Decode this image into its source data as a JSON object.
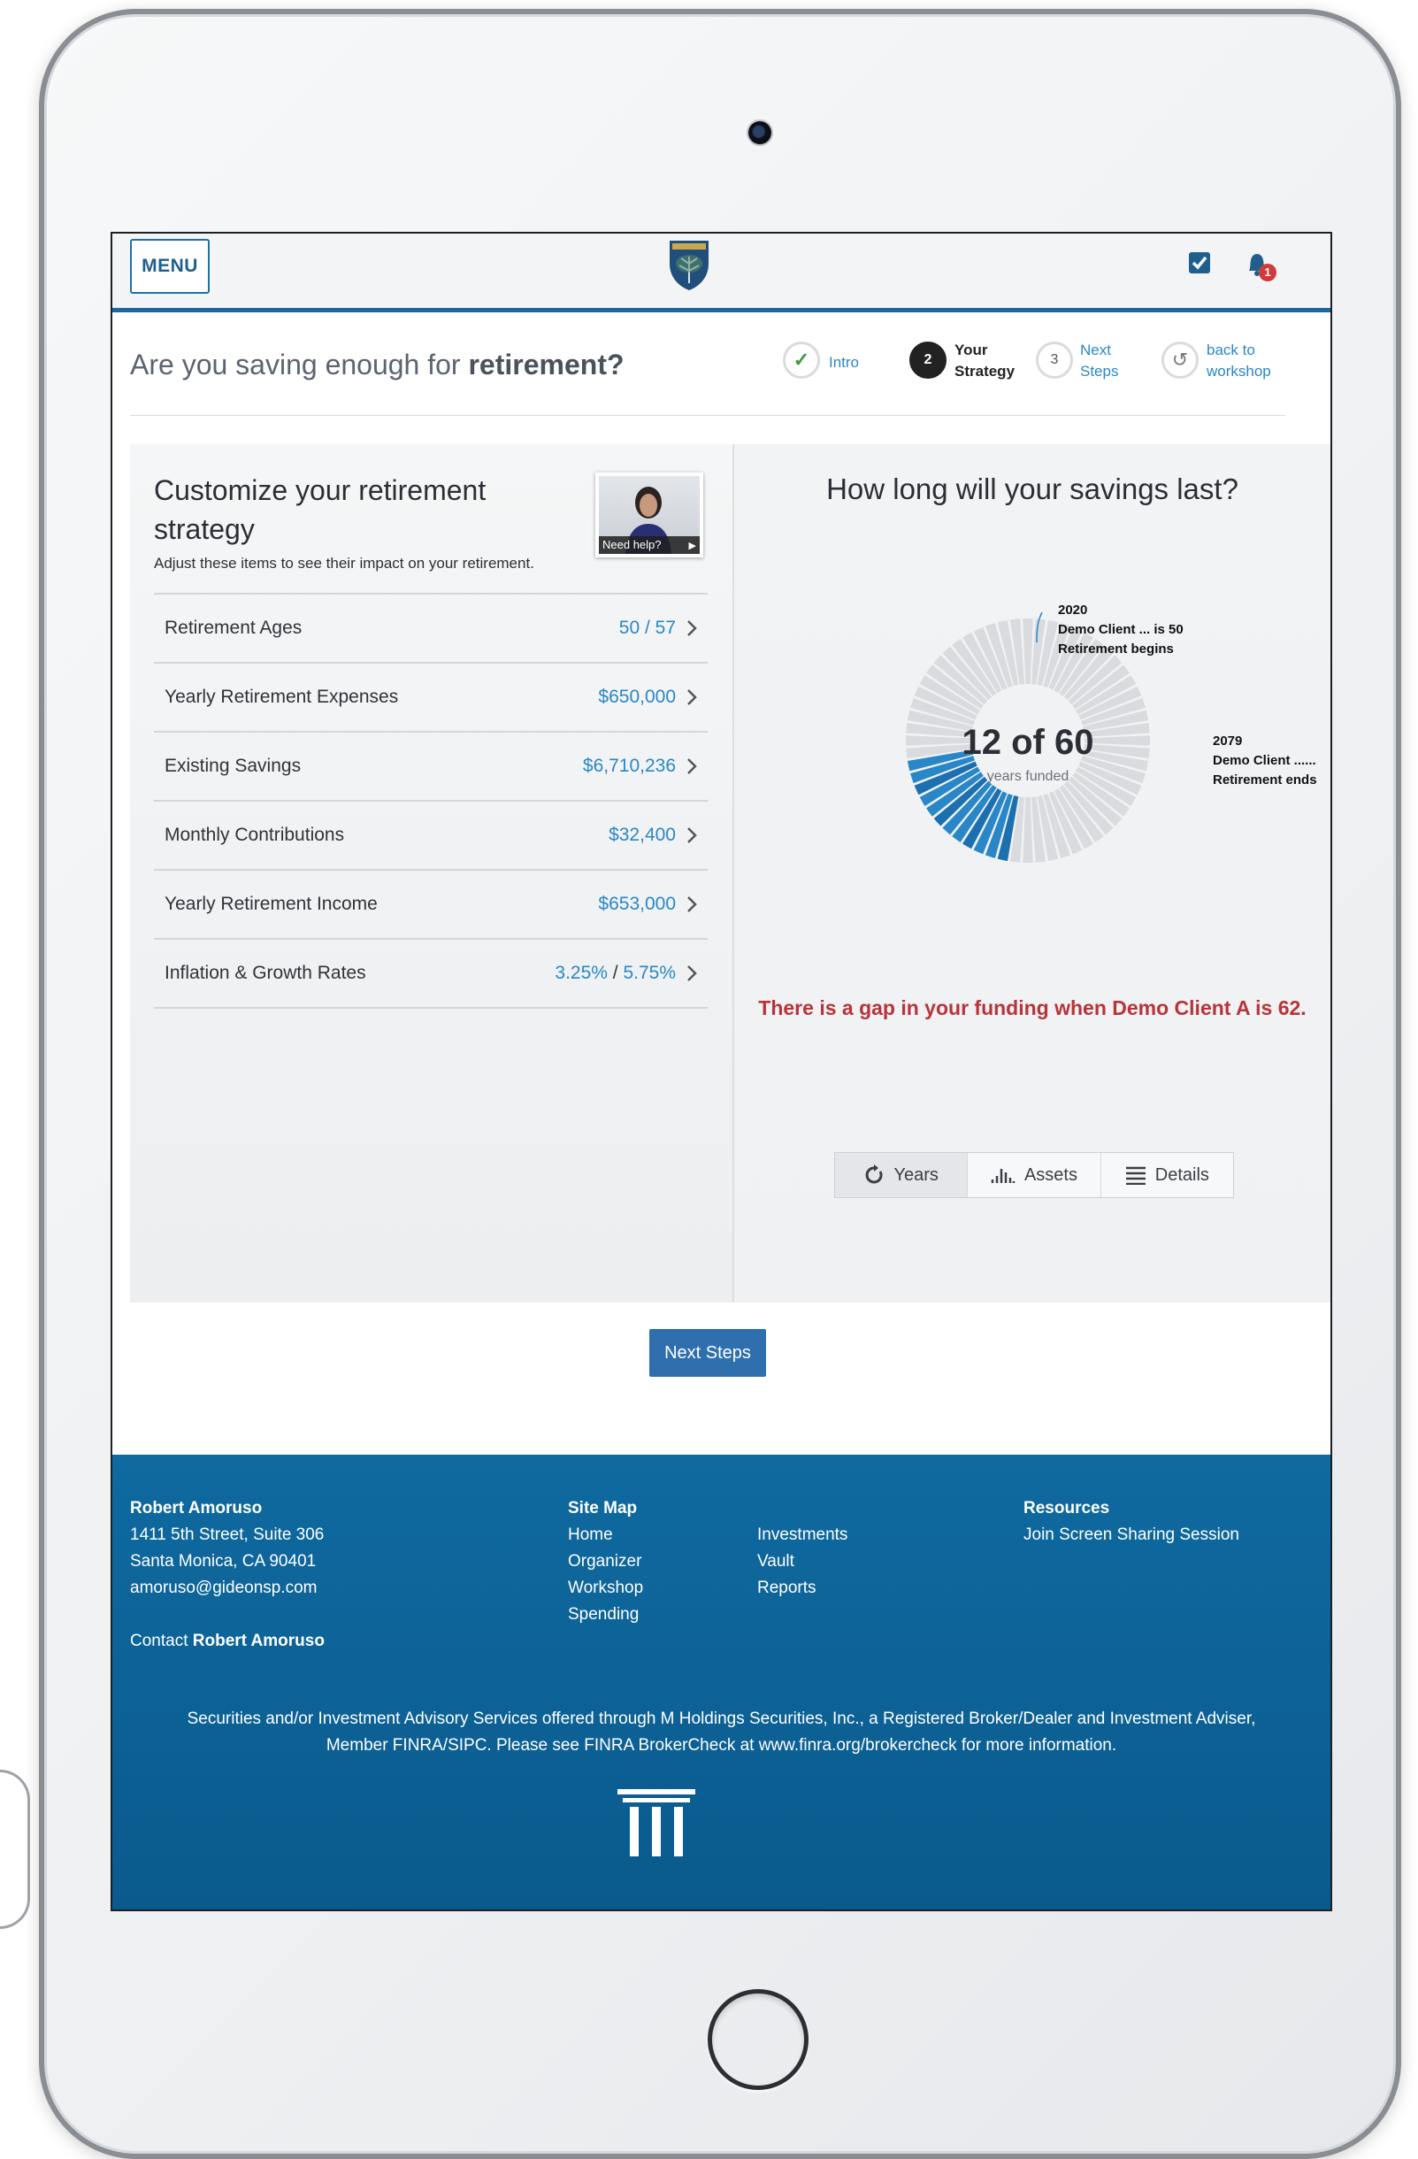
{
  "topbar": {
    "menu_label": "MENU",
    "notification_count": "1"
  },
  "header": {
    "title_prefix": "Are you saving enough for ",
    "title_bold": "retirement?"
  },
  "steps": [
    {
      "marker": "✓",
      "label_line1": "Intro",
      "label_line2": "",
      "state": "done"
    },
    {
      "marker": "2",
      "label_line1": "Your",
      "label_line2": "Strategy",
      "state": "active"
    },
    {
      "marker": "3",
      "label_line1": "Next",
      "label_line2": "Steps",
      "state": "pending"
    },
    {
      "marker": "↺",
      "label_line1": "back to",
      "label_line2": "workshop",
      "state": "link"
    }
  ],
  "customize": {
    "heading": "Customize your retirement strategy",
    "subheading": "Adjust these items to see their impact on your retirement.",
    "video_caption": "Need help?",
    "items": [
      {
        "label": "Retirement Ages",
        "value_a": "50",
        "sep": " / ",
        "value_b": "57"
      },
      {
        "label": "Yearly Retirement Expenses",
        "value_a": "$650,000",
        "sep": "",
        "value_b": ""
      },
      {
        "label": "Existing Savings",
        "value_a": "$6,710,236",
        "sep": "",
        "value_b": ""
      },
      {
        "label": "Monthly Contributions",
        "value_a": "$32,400",
        "sep": "",
        "value_b": ""
      },
      {
        "label": "Yearly Retirement Income",
        "value_a": "$653,000",
        "sep": "",
        "value_b": ""
      },
      {
        "label": "Inflation & Growth Rates",
        "value_a": "3.25%",
        "sep": " / ",
        "value_b": "5.75%"
      }
    ]
  },
  "chart": {
    "title": "How long will your savings last?",
    "center_big": "12 of 60",
    "center_small": "years funded",
    "start_label": {
      "year": "2020",
      "line1": "Demo Client ... is 50",
      "line2": "Retirement begins"
    },
    "end_label": {
      "year": "2079",
      "line1": "Demo Client ......",
      "line2": "Retirement ends"
    },
    "gap_message": "There is a gap in your funding when Demo Client A is 62.",
    "colors": {
      "funded": "#2a87c7",
      "funded_dark": "#1c70b0",
      "unfunded": "#d9dbde",
      "gap": "#b7343a"
    },
    "views": [
      {
        "label": "Years",
        "icon": "refresh-icon",
        "active": true
      },
      {
        "label": "Assets",
        "icon": "bar-chart-icon",
        "active": false
      },
      {
        "label": "Details",
        "icon": "list-icon",
        "active": false
      }
    ]
  },
  "chart_data": {
    "type": "pie",
    "title": "How long will your savings last?",
    "categories": [
      "years funded",
      "years unfunded"
    ],
    "values": [
      12,
      48
    ],
    "total_segments": 60,
    "start_year": 2020,
    "end_year": 2079
  },
  "actions": {
    "next_steps": "Next Steps"
  },
  "footer": {
    "advisor_name": "Robert Amoruso",
    "address1": "1411 5th Street, Suite 306",
    "address2": "Santa Monica, CA 90401",
    "email": "amoruso@gideonsp.com",
    "contact_prefix": "Contact ",
    "contact_name": "Robert Amoruso",
    "sitemap_title": "Site Map",
    "sitemap_col1": [
      "Home",
      "Organizer",
      "Workshop",
      "Spending"
    ],
    "sitemap_col2": [
      "Investments",
      "Vault",
      "Reports"
    ],
    "resources_title": "Resources",
    "resources_link": "Join Screen Sharing Session",
    "disclaimer1": "Securities and/or Investment Advisory Services offered through M Holdings Securities, Inc., a Registered Broker/Dealer and Investment Adviser,",
    "disclaimer2": "Member FINRA/SIPC. Please see FINRA BrokerCheck at www.finra.org/brokercheck for more information."
  }
}
